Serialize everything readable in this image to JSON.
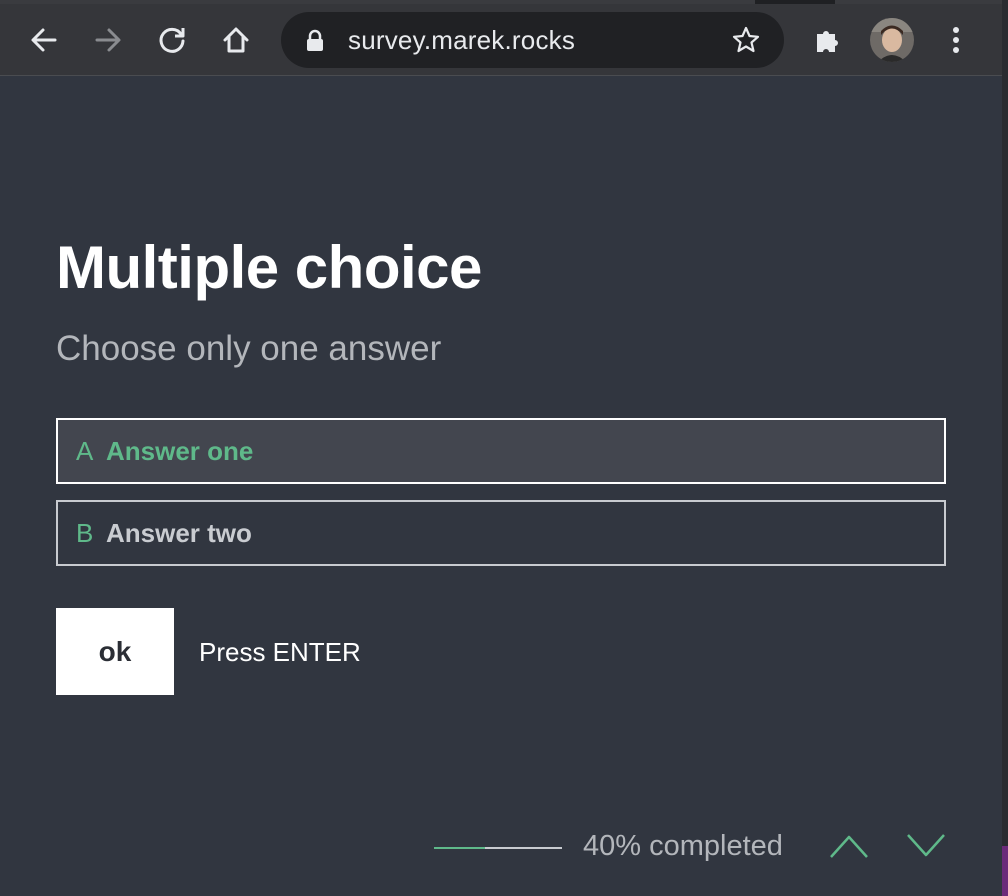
{
  "browser": {
    "url": "survey.marek.rocks",
    "icons": [
      "back-icon",
      "forward-icon",
      "reload-icon",
      "home-icon",
      "lock-icon",
      "star-icon",
      "extensions-icon",
      "avatar",
      "menu-icon"
    ]
  },
  "question": {
    "title": "Multiple choice",
    "subtitle": "Choose only one answer",
    "choices": [
      {
        "key": "A",
        "label": "Answer one",
        "selected": true
      },
      {
        "key": "B",
        "label": "Answer two",
        "selected": false
      }
    ],
    "ok_label": "ok",
    "hint": "Press ENTER"
  },
  "footer": {
    "progress_percent": 40,
    "progress_text": "40% completed"
  },
  "colors": {
    "background": "#313640",
    "accent": "#5fb98a",
    "text": "#ffffff",
    "muted": "#b3b6bb"
  }
}
